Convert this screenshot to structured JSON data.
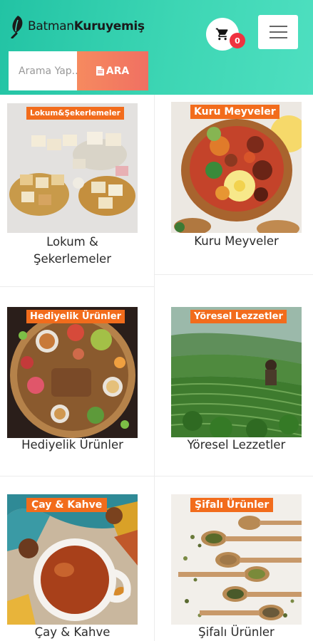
{
  "header": {
    "logo": {
      "part1": "Batman",
      "part2": "Kuruyemiş"
    },
    "cart": {
      "count": "0"
    }
  },
  "search": {
    "placeholder": "Arama Yap...",
    "button_label": "ARA"
  },
  "categories": [
    {
      "tag": "Lokum&Şekerlemeler",
      "title_line1": "Lokum &",
      "title_line2": "Şekerlemeler"
    },
    {
      "tag": "Kuru Meyveler",
      "title_line1": "Kuru Meyveler",
      "title_line2": ""
    },
    {
      "tag": "Hediyelik Ürünler",
      "title_line1": "Hediyelik Ürünler",
      "title_line2": ""
    },
    {
      "tag": "Yöresel Lezzetler",
      "title_line1": "Yöresel Lezzetler",
      "title_line2": ""
    },
    {
      "tag": "Çay & Kahve",
      "title_line1": "Çay & Kahve",
      "title_line2": ""
    },
    {
      "tag": "Şifalı Ürünler",
      "title_line1": "Şifalı Ürünler",
      "title_line2": ""
    }
  ],
  "colors": {
    "header_gradient": [
      "#22c3a4",
      "#4edfc0"
    ],
    "search_button": "#f07062",
    "tag_background": "#f26c1c",
    "badge": "#ef3340"
  },
  "icons": [
    "logo-leaf-icon",
    "cart-icon",
    "hamburger-menu-icon",
    "search-file-icon"
  ]
}
